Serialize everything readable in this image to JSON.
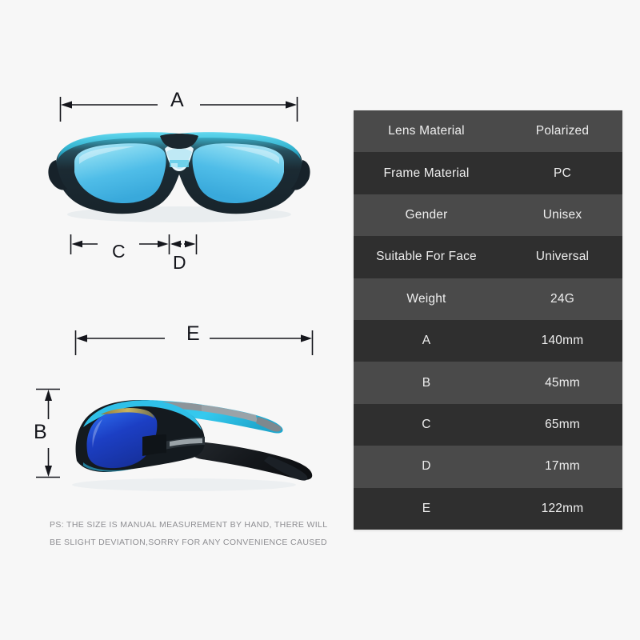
{
  "page": {
    "background_color": "#f7f7f7",
    "product": "polarized sport sunglasses size chart"
  },
  "dimensions": {
    "labels": {
      "a": "A",
      "b": "B",
      "c": "C",
      "d": "D",
      "e": "E"
    }
  },
  "illustrations": {
    "front_view": {
      "name": "sunglasses-front-view",
      "lens_color": "#58c2ea",
      "lens_highlight_color": "#a5e4f6",
      "frame_color": "#1d2a33",
      "accent_color": "#3fc5e0"
    },
    "side_view": {
      "name": "sunglasses-side-view",
      "lens_color": "#1f46c8",
      "frame_color": "#14161a",
      "accent_color": "#32c6ea",
      "temple_gray": "#8d9499"
    }
  },
  "disclaimer": {
    "line1": "PS: THE SIZE IS MANUAL MEASUREMENT BY HAND, THERE WILL",
    "line2": "BE SLIGHT DEVIATION,SORRY FOR ANY CONVENIENCE CAUSED",
    "color": "#8e8e92"
  },
  "spec_table": {
    "row_colors": {
      "odd": "#4a4a4a",
      "even": "#2f2f2f"
    },
    "text_color": "#eeeeee",
    "rows": [
      {
        "key": "Lens Material",
        "value": "Polarized"
      },
      {
        "key": "Frame Material",
        "value": "PC"
      },
      {
        "key": "Gender",
        "value": "Unisex"
      },
      {
        "key": "Suitable For Face",
        "value": "Universal"
      },
      {
        "key": "Weight",
        "value": "24G"
      },
      {
        "key": "A",
        "value": "140mm"
      },
      {
        "key": "B",
        "value": "45mm"
      },
      {
        "key": "C",
        "value": "65mm"
      },
      {
        "key": "D",
        "value": "17mm"
      },
      {
        "key": "E",
        "value": "122mm"
      }
    ]
  }
}
